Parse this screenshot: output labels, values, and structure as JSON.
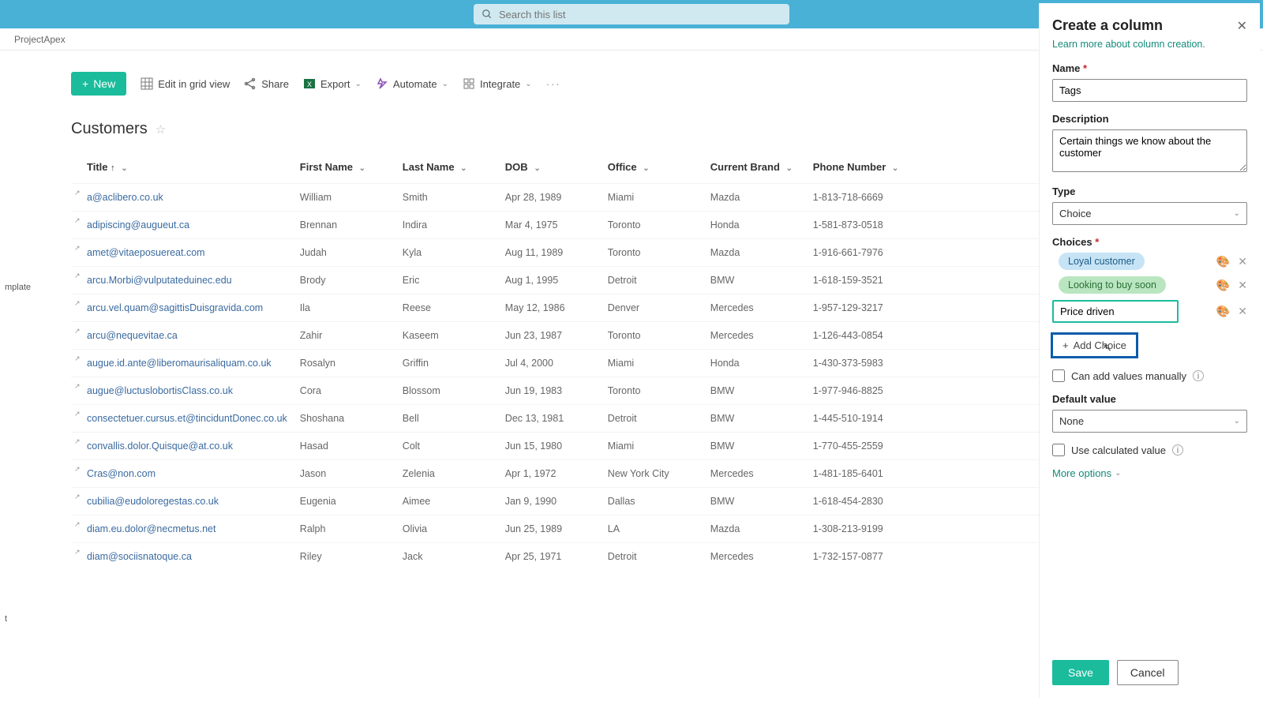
{
  "search": {
    "placeholder": "Search this list"
  },
  "breadcrumb": "ProjectApex",
  "sidebar": {
    "item1": "mplate",
    "item2": "t"
  },
  "toolbar": {
    "new": "New",
    "edit_grid": "Edit in grid view",
    "share": "Share",
    "export": "Export",
    "automate": "Automate",
    "integrate": "Integrate"
  },
  "list": {
    "title": "Customers"
  },
  "columns": {
    "title": "Title",
    "first_name": "First Name",
    "last_name": "Last Name",
    "dob": "DOB",
    "office": "Office",
    "current_brand": "Current Brand",
    "phone": "Phone Number"
  },
  "rows": [
    {
      "title": "a@aclibero.co.uk",
      "first": "William",
      "last": "Smith",
      "dob": "Apr 28, 1989",
      "office": "Miami",
      "brand": "Mazda",
      "phone": "1-813-718-6669"
    },
    {
      "title": "adipiscing@augueut.ca",
      "first": "Brennan",
      "last": "Indira",
      "dob": "Mar 4, 1975",
      "office": "Toronto",
      "brand": "Honda",
      "phone": "1-581-873-0518"
    },
    {
      "title": "amet@vitaeposuereat.com",
      "first": "Judah",
      "last": "Kyla",
      "dob": "Aug 11, 1989",
      "office": "Toronto",
      "brand": "Mazda",
      "phone": "1-916-661-7976"
    },
    {
      "title": "arcu.Morbi@vulputateduinec.edu",
      "first": "Brody",
      "last": "Eric",
      "dob": "Aug 1, 1995",
      "office": "Detroit",
      "brand": "BMW",
      "phone": "1-618-159-3521"
    },
    {
      "title": "arcu.vel.quam@sagittisDuisgravida.com",
      "first": "Ila",
      "last": "Reese",
      "dob": "May 12, 1986",
      "office": "Denver",
      "brand": "Mercedes",
      "phone": "1-957-129-3217"
    },
    {
      "title": "arcu@nequevitae.ca",
      "first": "Zahir",
      "last": "Kaseem",
      "dob": "Jun 23, 1987",
      "office": "Toronto",
      "brand": "Mercedes",
      "phone": "1-126-443-0854"
    },
    {
      "title": "augue.id.ante@liberomaurisaliquam.co.uk",
      "first": "Rosalyn",
      "last": "Griffin",
      "dob": "Jul 4, 2000",
      "office": "Miami",
      "brand": "Honda",
      "phone": "1-430-373-5983"
    },
    {
      "title": "augue@luctuslobortisClass.co.uk",
      "first": "Cora",
      "last": "Blossom",
      "dob": "Jun 19, 1983",
      "office": "Toronto",
      "brand": "BMW",
      "phone": "1-977-946-8825"
    },
    {
      "title": "consectetuer.cursus.et@tinciduntDonec.co.uk",
      "first": "Shoshana",
      "last": "Bell",
      "dob": "Dec 13, 1981",
      "office": "Detroit",
      "brand": "BMW",
      "phone": "1-445-510-1914"
    },
    {
      "title": "convallis.dolor.Quisque@at.co.uk",
      "first": "Hasad",
      "last": "Colt",
      "dob": "Jun 15, 1980",
      "office": "Miami",
      "brand": "BMW",
      "phone": "1-770-455-2559"
    },
    {
      "title": "Cras@non.com",
      "first": "Jason",
      "last": "Zelenia",
      "dob": "Apr 1, 1972",
      "office": "New York City",
      "brand": "Mercedes",
      "phone": "1-481-185-6401"
    },
    {
      "title": "cubilia@eudoloregestas.co.uk",
      "first": "Eugenia",
      "last": "Aimee",
      "dob": "Jan 9, 1990",
      "office": "Dallas",
      "brand": "BMW",
      "phone": "1-618-454-2830"
    },
    {
      "title": "diam.eu.dolor@necmetus.net",
      "first": "Ralph",
      "last": "Olivia",
      "dob": "Jun 25, 1989",
      "office": "LA",
      "brand": "Mazda",
      "phone": "1-308-213-9199"
    },
    {
      "title": "diam@sociisnatoque.ca",
      "first": "Riley",
      "last": "Jack",
      "dob": "Apr 25, 1971",
      "office": "Detroit",
      "brand": "Mercedes",
      "phone": "1-732-157-0877"
    }
  ],
  "panel": {
    "title": "Create a column",
    "learn_more": "Learn more about column creation.",
    "name_label": "Name",
    "name_value": "Tags",
    "desc_label": "Description",
    "desc_value": "Certain things we know about the customer",
    "type_label": "Type",
    "type_value": "Choice",
    "choices_label": "Choices",
    "choice1": "Loyal customer",
    "choice2": "Looking to buy soon",
    "choice3": "Price driven",
    "add_choice": "Add Choice",
    "manual_label": "Can add values manually",
    "default_label": "Default value",
    "default_value": "None",
    "calc_label": "Use calculated value",
    "more_options": "More options",
    "save": "Save",
    "cancel": "Cancel"
  }
}
